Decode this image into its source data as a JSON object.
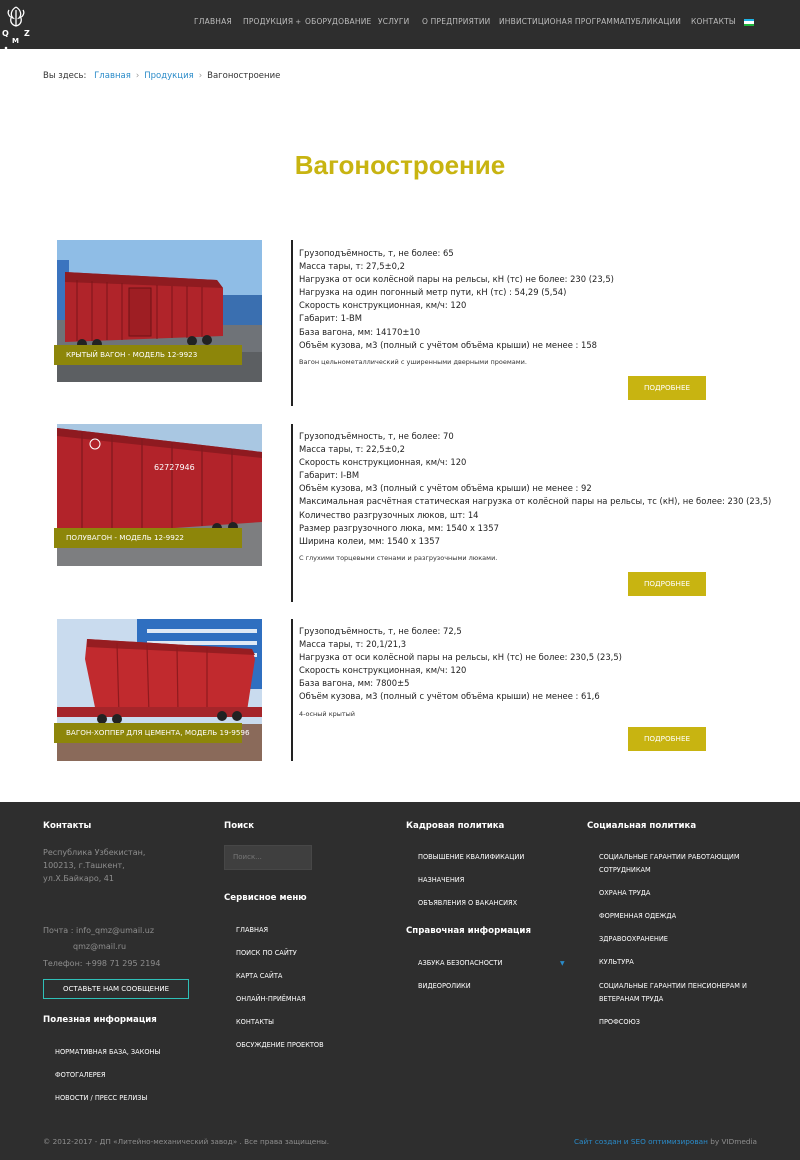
{
  "header": {
    "logo_alt": "QMZ",
    "nav": [
      {
        "label": "Главная"
      },
      {
        "label": "Продукция",
        "caret": "+"
      },
      {
        "label": "Оборудование"
      },
      {
        "label": "Услуги"
      },
      {
        "label": "О предприятии"
      },
      {
        "label": "Инвистиционая программа"
      },
      {
        "label": "Публикации"
      },
      {
        "label": "Контакты"
      }
    ],
    "language_flag": "uzbekistan-flag"
  },
  "breadcrumb": {
    "prefix": "Вы здесь:",
    "items": [
      "Главная",
      "Продукция",
      "Вагоностроение"
    ],
    "separator": "›"
  },
  "page_title": "Вагоностроение",
  "colors": {
    "accent": "#c8b411",
    "label_bg": "#8d860a",
    "header_bg": "#2e2e2e",
    "link": "#2a8bc9",
    "footer_button_border": "#2fc0b8"
  },
  "products": [
    {
      "label": "Крытый вагон - модель 12-9923",
      "specs": [
        "Грузоподъёмность, т, не более:   65",
        "Масса тары, т:   27,5±0,2",
        "Нагрузка от оси колёсной пары на рельсы, кН (тс) не более:   230 (23,5)",
        "Нагрузка на один погонный метр пути, кН (тс) :   54,29 (5,54)",
        "Скорость конструкционная, км/ч:   120",
        "Габарит:   1-ВМ",
        "База вагона, мм:   14170±10",
        "Объём кузова, м3 (полный с учётом объёма крыши) не менее :   158"
      ],
      "note": "Вагон цельнометаллический с уширенными дверными проемами.",
      "button": "Подробнее"
    },
    {
      "label": "Полувагон - модель 12-9922",
      "specs": [
        "Грузоподъёмность, т, не более:   70",
        "Масса тары, т:   22,5±0,2",
        "Скорость конструкционная, км/ч:   120",
        "Габарит:   I-ВМ",
        "Объём кузова, м3 (полный с учётом объёма крыши) не менее :   92",
        "Максимальная расчётная статическая нагрузка от колёсной пары на рельсы, тс (кН), не более:   230 (23,5)",
        "Количество разгрузочных люков, шт:   14",
        "Размер разгрузочного люка, мм:   1540 х 1357",
        "Ширина колеи, мм:   1540 х 1357"
      ],
      "note": "С глухими торцевыми стенами и разгрузочными люками.",
      "button": "Подробнее"
    },
    {
      "label": "Вагон-хоппер для цемента, модель 19-9596",
      "specs": [
        "Грузоподъёмность, т, не более:   72,5",
        "Масса тары, т:   20,1/21,3",
        "Нагрузка от оси колёсной пары на рельсы, кН (тс) не более:   230,5 (23,5)",
        "Скорость конструкционная, км/ч:   120",
        "База вагона, мм:   7800±5",
        "Объём кузова, м3 (полный с учётом объёма крыши) не менее :   61,6"
      ],
      "note": "4-осный крытый",
      "button": "Подробнее"
    }
  ],
  "footer": {
    "contacts": {
      "title": "Контакты",
      "address": [
        "Республика Узбекистан,",
        "100213, г.Ташкент,",
        "ул.Х.Байкаро, 41"
      ],
      "email_line1": "Почта : info_qmz@umail.uz",
      "email_line2": "qmz@mail.ru",
      "phone": "Телефон: +998 71 295 2194",
      "message_button": "Оставьте нам сообщение"
    },
    "useful": {
      "title": "Полезная информация",
      "links": [
        "Нормативная база, законы",
        "Фотогалерея",
        "Новости / пресс релизы"
      ]
    },
    "search": {
      "title": "Поиск",
      "placeholder": "Поиск..."
    },
    "service": {
      "title": "Сервисное меню",
      "links": [
        "Главная",
        "Поиск по сайту",
        "Карта сайта",
        "Онлайн-приёмная",
        "Контакты",
        "Обсуждение проектов"
      ]
    },
    "hr": {
      "title": "Кадровая политика",
      "links": [
        "Повышение квалификации",
        "Назначения",
        "Объявления о вакансиях"
      ]
    },
    "reference": {
      "title": "Справочная информация",
      "links": [
        "Азбука безопасности",
        "Видеоролики"
      ]
    },
    "social": {
      "title": "Социальная политика",
      "links": [
        "Социальные гарантии работающим",
        "сотрудникам",
        "Охрана труда",
        "Форменная одежда",
        "Здравоохранение",
        "Культура",
        "Социальные гарантии пенсионерам и",
        "ветеранам труда",
        "Профсоюз"
      ]
    },
    "copyright": "© 2012-2017 - ДП «Литейно-механический завод» . Все права защищены.",
    "credits_link": "Сайт создан и SEO оптимизирован",
    "credits_by": " by VIDmedia"
  }
}
